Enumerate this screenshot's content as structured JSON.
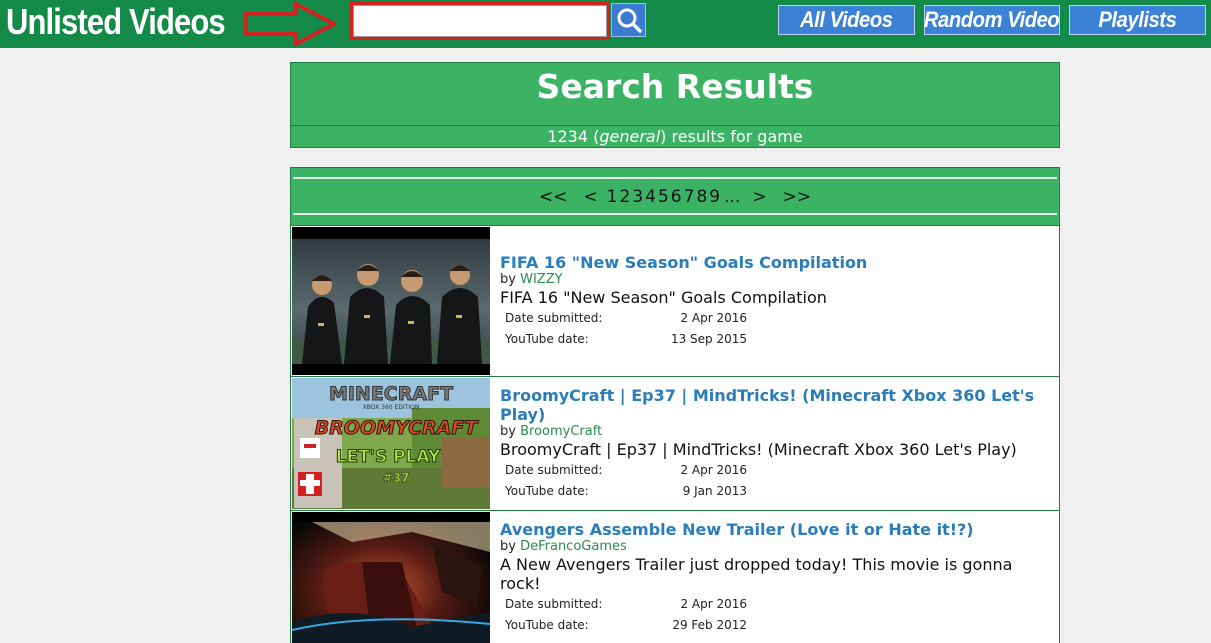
{
  "header": {
    "logo": "Unlisted Videos",
    "search": {
      "value": "",
      "placeholder": ""
    },
    "nav": {
      "all_videos": "All Videos",
      "random_video": "Random Video",
      "playlists": "Playlists"
    }
  },
  "summary": {
    "title": "Search Results",
    "count": "1234",
    "scope": "general",
    "text_mid": ") results for",
    "query": "game"
  },
  "pagination": {
    "first": "<<",
    "prev": "<",
    "pages": [
      "1",
      "2",
      "3",
      "4",
      "5",
      "6",
      "7",
      "8",
      "9"
    ],
    "current": "1",
    "ellipsis": "...",
    "next": ">",
    "last": ">>"
  },
  "labels": {
    "by": "by",
    "date_submitted": "Date submitted:",
    "youtube_date": "YouTube date:"
  },
  "results": [
    {
      "title": "FIFA 16 \"New Season\" Goals Compilation",
      "author": "WIZZY",
      "description": "FIFA 16 \"New Season\" Goals Compilation",
      "date_submitted": "2 Apr 2016",
      "youtube_date": "13 Sep 2015",
      "thumbnail": "fifa-players-thumbnail"
    },
    {
      "title": "BroomyCraft | Ep37 | MindTricks! (Minecraft Xbox 360 Let's Play)",
      "author": "BroomyCraft",
      "description": "BroomyCraft | Ep37 | MindTricks! (Minecraft Xbox 360 Let's Play)",
      "date_submitted": "2 Apr 2016",
      "youtube_date": "9 Jan 2013",
      "thumbnail": "minecraft-thumbnail",
      "thumb_text": {
        "brand": "MINECRAFT",
        "edition": "XBOX 360 EDITION",
        "show": "BROOMYCRAFT",
        "series": "LET'S PLAY",
        "episode": "#37"
      }
    },
    {
      "title": "Avengers Assemble New Trailer (Love it or Hate it!?)",
      "author": "DeFrancoGames",
      "description": "A New Avengers Trailer just dropped today! This movie is gonna rock!",
      "date_submitted": "2 Apr 2016",
      "youtube_date": "29 Feb 2012",
      "thumbnail": "avengers-thumbnail"
    }
  ],
  "colors": {
    "topbar": "#138a47",
    "panel_green": "#3cb364",
    "nav_button": "#3b82d6",
    "link_blue": "#2a7db8",
    "author_green": "#2b8a4e",
    "highlight_red": "#d32222"
  }
}
